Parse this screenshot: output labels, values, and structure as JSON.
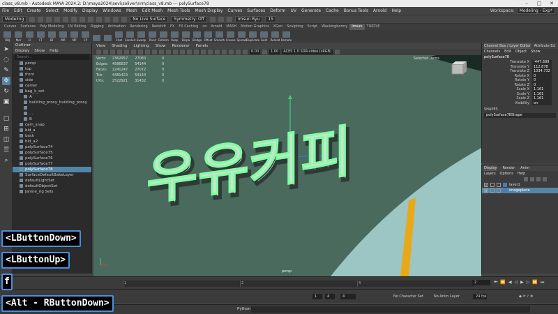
{
  "titlebar": {
    "title": "class_v8.mb - Autodesk MAYA 2024.2: D:\\maya2024\\sevi\\soliver\\nrn\\class_v8.mb  ---  polySurface78",
    "min": "–",
    "max": "□",
    "close": "✕"
  },
  "menubar": {
    "items": [
      "File",
      "Edit",
      "Create",
      "Select",
      "Modify",
      "Display",
      "Windows",
      "Mesh",
      "Edit Mesh",
      "Mesh Tools",
      "Mesh Display",
      "Curves",
      "Surfaces",
      "Deform",
      "UV",
      "Generate",
      "Cache",
      "Bonus Tools",
      "Arnold",
      "Help"
    ],
    "workspace_label": "Workspace:",
    "workspace_value": "Modeling - Exp*"
  },
  "statusline": {
    "mode": "Modeling",
    "live_surface": "No Live Surface",
    "symmetry": "Symmetry: Off",
    "user": "Imsun Ryu",
    "credits": "15"
  },
  "shelf": {
    "tabs": [
      "Curves",
      "Surfaces",
      "Poly Modeling",
      "UV Editing",
      "Rigging",
      "Animation",
      "Rendering",
      "Redshift",
      "FX",
      "FX Caching",
      "ce",
      "Arnold",
      "MASH",
      "Motion Graphics",
      "XGen",
      "Sculpting",
      "Script",
      "Wackingbormy",
      "Imsun",
      "TURTLE"
    ],
    "active_tab": "Imsun",
    "items": [
      "OBJ",
      "Mer",
      "Cl",
      "FT",
      "BF",
      "MR",
      "MP",
      "CP",
      "",
      "",
      "Chat",
      "Conduit",
      "Sweep",
      "Pivot",
      "Deform",
      "Keep",
      "Dispa",
      "Bridge",
      "Offset",
      "Smooth",
      "Crease",
      "Spread",
      "Duplicate",
      "Gold",
      "Reload",
      "Remote"
    ]
  },
  "outliner": {
    "title": "Outliner",
    "menu": [
      "Display",
      "Show",
      "Help"
    ],
    "search_placeholder": "Search...",
    "rows": [
      {
        "label": "persp",
        "selected": false,
        "indent": 1
      },
      {
        "label": "top",
        "selected": false,
        "indent": 1
      },
      {
        "label": "front",
        "selected": false,
        "indent": 1
      },
      {
        "label": "side",
        "selected": false,
        "indent": 1
      },
      {
        "label": "camer",
        "selected": false,
        "indent": 1
      },
      {
        "label": "bag_k_set",
        "selected": false,
        "indent": 1
      },
      {
        "label": "A",
        "selected": false,
        "indent": 2
      },
      {
        "label": "building_proxy_building_proxy",
        "selected": false,
        "indent": 2
      },
      {
        "label": "",
        "selected": false,
        "indent": 2
      },
      {
        "label": "...",
        "selected": false,
        "indent": 2
      },
      {
        "label": "B",
        "selected": false,
        "indent": 2
      },
      {
        "label": "cam_snap",
        "selected": false,
        "indent": 1
      },
      {
        "label": "bld_a",
        "selected": false,
        "indent": 1
      },
      {
        "label": "back",
        "selected": false,
        "indent": 1
      },
      {
        "label": "bld_a2",
        "selected": false,
        "indent": 1
      },
      {
        "label": "polySurface74",
        "selected": false,
        "indent": 1
      },
      {
        "label": "polySurface75",
        "selected": false,
        "indent": 1
      },
      {
        "label": "polySurface76",
        "selected": false,
        "indent": 1
      },
      {
        "label": "polySurface77",
        "selected": false,
        "indent": 1
      },
      {
        "label": "polySurface78",
        "selected": true,
        "indent": 1
      },
      {
        "label": "SurfaceDefaultBakeLayer",
        "selected": false,
        "indent": 1
      },
      {
        "label": "defaultLightSet",
        "selected": false,
        "indent": 1
      },
      {
        "label": "defaultObjectSet",
        "selected": false,
        "indent": 1
      },
      {
        "label": "Janine_rig Sets",
        "selected": false,
        "indent": 1
      }
    ]
  },
  "viewport": {
    "menu": [
      "View",
      "Shading",
      "Lighting",
      "Show",
      "Renderer",
      "Panels"
    ],
    "value_a": "0.00",
    "value_b": "1.00",
    "color_space": "ACES 1.0 SDR-video (sRGB)",
    "selected_label": "Selected Items",
    "hud": [
      {
        "label": "Verts:",
        "a": "2362957",
        "b": "27083",
        "c": "0"
      },
      {
        "label": "Edges:",
        "a": "4586837",
        "b": "54144",
        "c": "0"
      },
      {
        "label": "Faces:",
        "a": "2241247",
        "b": "27072",
        "c": "0"
      },
      {
        "label": "Tris:",
        "a": "4481423",
        "b": "54144",
        "c": "0"
      },
      {
        "label": "UVs:",
        "a": "2522921",
        "b": "31432",
        "c": "0"
      }
    ],
    "camera": "persp",
    "text_3d": "우유커피"
  },
  "channelbox": {
    "tabs": [
      "Channel Box / Layer Editor",
      "Attribute Ed"
    ],
    "menu": [
      "Channels",
      "Edit",
      "Object",
      "Show"
    ],
    "object": "polySurface78",
    "attrs": [
      {
        "label": "Translate X",
        "value": "-447.699"
      },
      {
        "label": "Translate Y",
        "value": "112.878"
      },
      {
        "label": "Translate Z",
        "value": "1034.732"
      },
      {
        "label": "Rotate X",
        "value": "0"
      },
      {
        "label": "Rotate Y",
        "value": "0"
      },
      {
        "label": "Rotate Z",
        "value": "0"
      },
      {
        "label": "Scale X",
        "value": "1.161"
      },
      {
        "label": "Scale Y",
        "value": "1.161"
      },
      {
        "label": "Scale Z",
        "value": "1.161"
      },
      {
        "label": "Visibility",
        "value": "on"
      }
    ],
    "shapes_label": "SHAPES",
    "shape_name": "polySurface78Shape"
  },
  "layereditor": {
    "tabs": [
      "Display",
      "Render",
      "Anim"
    ],
    "menu": [
      "Layers",
      "Options",
      "Help"
    ],
    "layers": [
      {
        "name": "layer1",
        "selected": false
      },
      {
        "name": "imageplane",
        "selected": true
      }
    ]
  },
  "timeslider": {
    "labels": [
      "1",
      "2",
      "3",
      "4"
    ],
    "current": "2"
  },
  "rangeslider": {
    "start": "1",
    "start2": "4",
    "end2": "4",
    "char_set": "No Character Set",
    "anim_layer": "No Anim Layer",
    "fps": "24 fps"
  },
  "cmdline": {
    "lang": "Python"
  },
  "key_overlays": [
    "<LButtonDown>",
    "<LButtonUp>",
    "f",
    "<Alt - RButtonDown>"
  ],
  "colors": {
    "viewport_bg": "#4a6a5e",
    "selection": "#5285a6",
    "overlay_border": "#4a8fe0",
    "wireframe": "#7fffa0"
  }
}
